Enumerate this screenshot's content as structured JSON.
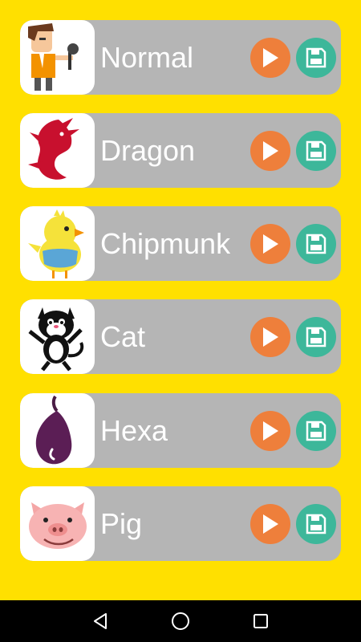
{
  "colors": {
    "background": "#FFE000",
    "row": "#B5B5B5",
    "play": "#EE7F3B",
    "save": "#3DB79A",
    "navbar": "#000000"
  },
  "effects": [
    {
      "label": "Normal",
      "icon": "man-with-microphone-icon"
    },
    {
      "label": "Dragon",
      "icon": "dragon-icon"
    },
    {
      "label": "Chipmunk",
      "icon": "chick-icon"
    },
    {
      "label": "Cat",
      "icon": "cat-icon"
    },
    {
      "label": "Hexa",
      "icon": "eggplant-icon"
    },
    {
      "label": "Pig",
      "icon": "pig-face-icon"
    }
  ],
  "row_buttons": {
    "play_icon": "play-icon",
    "save_icon": "save-floppy-icon"
  },
  "navbar": {
    "back_icon": "back-triangle-icon",
    "home_icon": "home-circle-icon",
    "recents_icon": "recents-square-icon"
  }
}
